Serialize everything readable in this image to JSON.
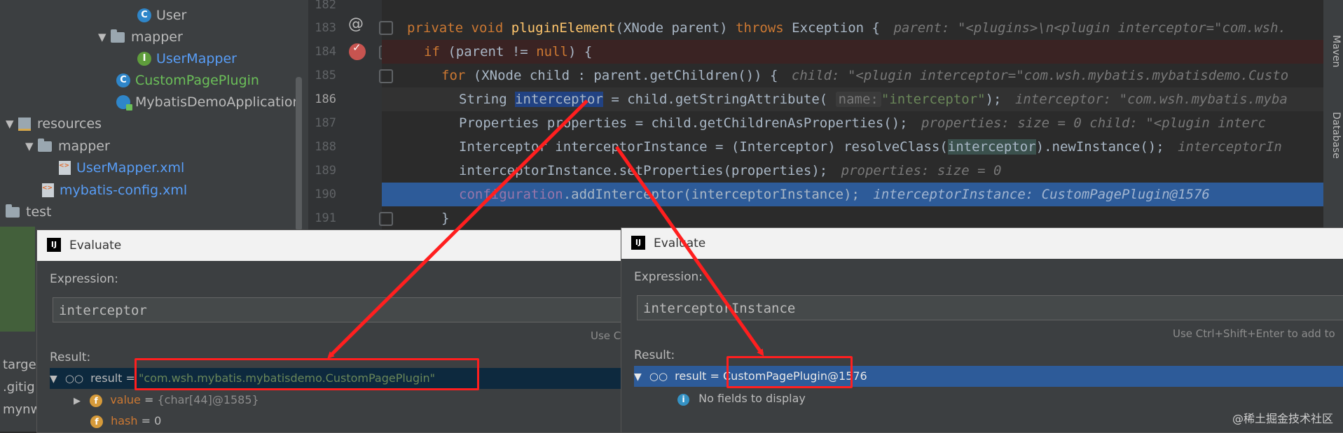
{
  "project_tree": {
    "items": [
      {
        "label": "User"
      },
      {
        "label": "mapper"
      },
      {
        "label": "UserMapper"
      },
      {
        "label": "CustomPagePlugin"
      },
      {
        "label": "MybatisDemoApplication"
      },
      {
        "label": "resources"
      },
      {
        "label": "mapper"
      },
      {
        "label": "UserMapper.xml"
      },
      {
        "label": "mybatis-config.xml"
      },
      {
        "label": "test"
      }
    ],
    "lower_items": [
      {
        "label": "targe"
      },
      {
        "label": ".gitig"
      },
      {
        "label": "mynw"
      }
    ]
  },
  "editor": {
    "line_numbers": [
      "182",
      "183",
      "184",
      "185",
      "186",
      "187",
      "188",
      "189",
      "190",
      "191"
    ],
    "l183": {
      "kw1": "private",
      "kw2": "void",
      "fn": "pluginElement",
      "params": "(XNode parent)",
      "kw3": "throws",
      "rest": "Exception {",
      "comment": "parent: \"<plugins>\\n<plugin interceptor=\"com.wsh."
    },
    "l184": {
      "kw1": "if",
      "pre": "(parent != ",
      "kw2": "null",
      "post": ") {"
    },
    "l185": {
      "kw1": "for",
      "code": "(XNode child : parent.getChildren()) {",
      "comment": "child: \"<plugin interceptor=\"com.wsh.mybatis.mybatisdemo.Custo"
    },
    "l186": {
      "pre": "String ",
      "sel": "interceptor",
      "mid": " = child.getStringAttribute(",
      "hint": "name:",
      "str": "\"interceptor\"",
      "post": ");",
      "comment": "interceptor: \"com.wsh.mybatis.myba"
    },
    "l187": {
      "code": "Properties properties = child.getChildrenAsProperties();",
      "comment": "properties:  size = 0  child: \"<plugin interc"
    },
    "l188": {
      "pre": "Interceptor interceptorInstance = (Interceptor) resolveClass(",
      "paren": "interceptor",
      "post": ").newInstance();",
      "comment": "interceptorIn"
    },
    "l189": {
      "code": "interceptorInstance.setProperties(properties);",
      "comment": "properties:  size = 0"
    },
    "l190": {
      "field": "configuration",
      "code": ".addInterceptor(interceptorInstance);",
      "comment": "interceptorInstance: CustomPagePlugin@1576"
    },
    "l191": {
      "code": "}"
    },
    "right_tabs": [
      "Maven",
      "Database"
    ]
  },
  "dialog_left": {
    "title": "Evaluate",
    "expression_label": "Expression:",
    "expression_value": "interceptor",
    "hint": "Use C",
    "result_label": "Result:",
    "result_name": "result",
    "result_eq": " = ",
    "result_value": "\"com.wsh.mybatis.mybatisdemo.CustomPagePlugin\"",
    "children": [
      {
        "name": "value",
        "value": "{char[44]@1585}"
      },
      {
        "name": "hash",
        "value": "0"
      }
    ]
  },
  "dialog_right": {
    "title": "Evaluate",
    "expression_label": "Expression:",
    "expression_value": "interceptorInstance",
    "hint": "Use Ctrl+Shift+Enter to add to",
    "result_label": "Result:",
    "result_name": "result",
    "result_eq": " = ",
    "result_value": "CustomPagePlugin@1576",
    "no_fields": "No fields to display"
  },
  "watermark": "@稀土掘金技术社区",
  "colors": {
    "annotation_red": "#ff1f1f",
    "exec_line": "#2d5b99"
  }
}
